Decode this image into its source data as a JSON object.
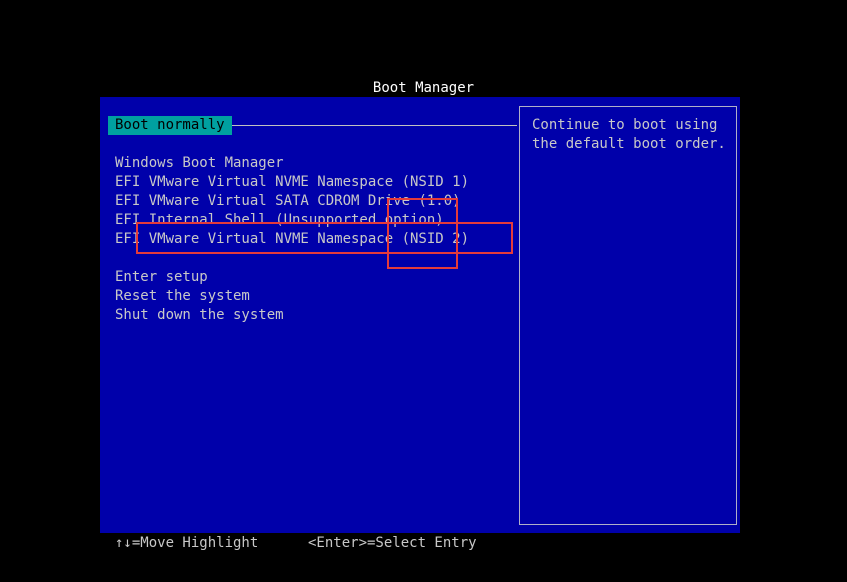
{
  "header": {
    "title": "Boot Manager"
  },
  "menu": {
    "selected": "Boot normally",
    "boot_items": [
      "Windows Boot Manager",
      "EFI VMware Virtual NVME Namespace (NSID 1)",
      "EFI VMware Virtual SATA CDROM Drive (1.0)",
      "EFI Internal Shell (Unsupported option)",
      "EFI VMware Virtual NVME Namespace (NSID 2)"
    ],
    "actions": [
      "Enter setup",
      "Reset the system",
      "Shut down the system"
    ]
  },
  "help": {
    "text": "Continue to boot using\nthe default boot order."
  },
  "footer": {
    "move_hint": "↑↓=Move Highlight",
    "select_hint": "<Enter>=Select Entry"
  },
  "colors": {
    "background": "#0000aa",
    "highlight": "#00a0a0",
    "annotation": "#e43b3b"
  }
}
